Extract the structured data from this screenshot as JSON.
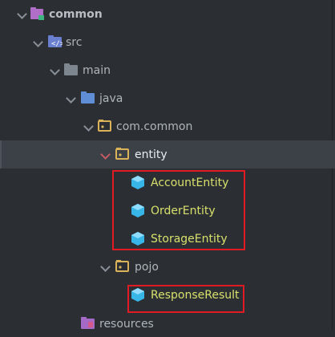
{
  "tree": {
    "items": [
      {
        "label": "common",
        "icon": "module-icon"
      },
      {
        "label": "src",
        "icon": "source-root-icon"
      },
      {
        "label": "main",
        "icon": "folder-icon"
      },
      {
        "label": "java",
        "icon": "source-folder-icon"
      },
      {
        "label": "com.common",
        "icon": "package-icon"
      },
      {
        "label": "entity",
        "icon": "package-icon",
        "selected": true
      },
      {
        "label": "AccountEntity",
        "icon": "class-icon"
      },
      {
        "label": "OrderEntity",
        "icon": "class-icon"
      },
      {
        "label": "StorageEntity",
        "icon": "class-icon"
      },
      {
        "label": "pojo",
        "icon": "package-icon"
      },
      {
        "label": "ResponseResult",
        "icon": "class-icon"
      },
      {
        "label": "resources",
        "icon": "resources-folder-icon"
      }
    ]
  },
  "colors": {
    "background": "#2b2f33",
    "selection": "#3b4147",
    "class_name": "#d8e06c",
    "highlight_box": "#e11b23",
    "class_icon": "#38b6e8"
  }
}
